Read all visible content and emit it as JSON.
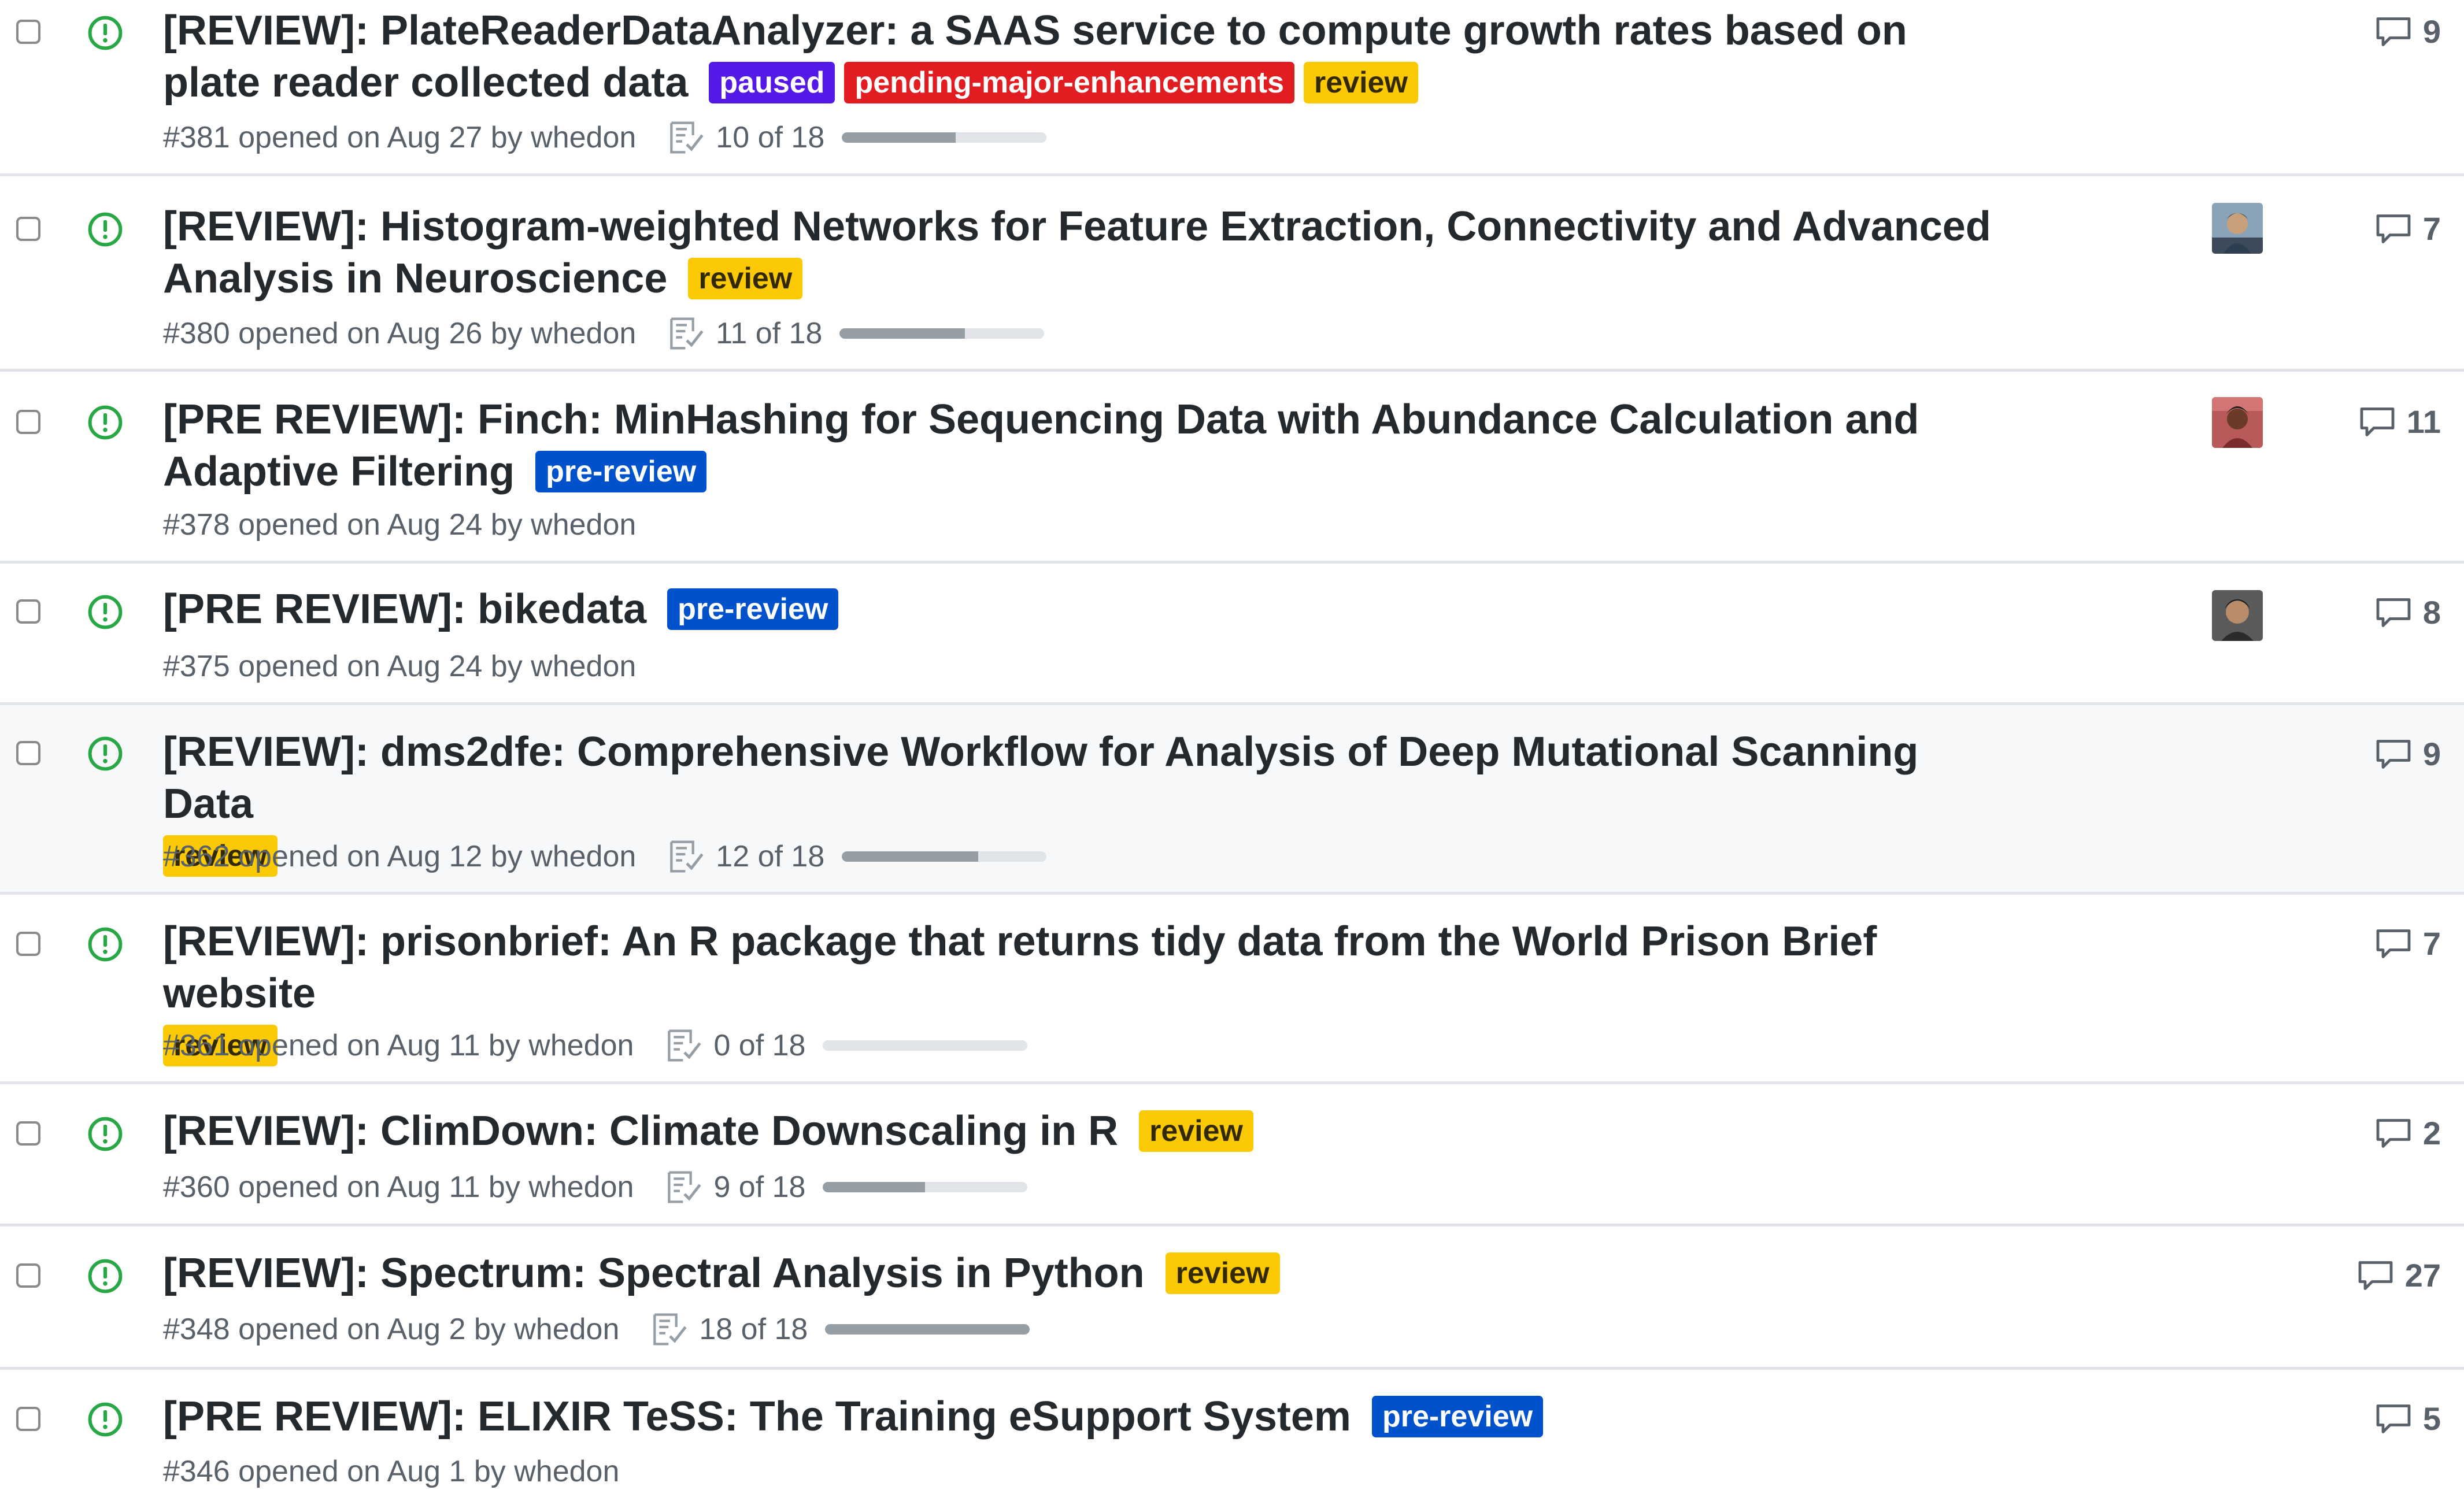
{
  "issues": [
    {
      "title": "[REVIEW]: PlateReaderDataAnalyzer: a SAAS service to compute growth rates based on plate reader collected data",
      "labels": [
        {
          "text": "paused",
          "kind": "paused"
        },
        {
          "text": "pending-major-enhancements",
          "kind": "pme"
        },
        {
          "text": "review",
          "kind": "review"
        }
      ],
      "meta": "#381 opened on Aug 27 by whedon",
      "tasks_text": "10 of 18",
      "tasks_progress": 0.556,
      "comments": "9",
      "has_avatar": false
    },
    {
      "title": "[REVIEW]: Histogram-weighted Networks for Feature Extraction, Connectivity and Advanced Analysis in Neuroscience",
      "labels": [
        {
          "text": "review",
          "kind": "review"
        }
      ],
      "meta": "#380 opened on Aug 26 by whedon",
      "tasks_text": "11 of 18",
      "tasks_progress": 0.611,
      "comments": "7",
      "has_avatar": true
    },
    {
      "title": "[PRE REVIEW]: Finch: MinHashing for Sequencing Data with Abundance Calculation and Adaptive Filtering",
      "labels": [
        {
          "text": "pre-review",
          "kind": "pre"
        }
      ],
      "meta": "#378 opened on Aug 24 by whedon",
      "tasks_text": null,
      "tasks_progress": null,
      "comments": "11",
      "has_avatar": true
    },
    {
      "title": "[PRE REVIEW]: bikedata",
      "labels": [
        {
          "text": "pre-review",
          "kind": "pre"
        }
      ],
      "meta": "#375 opened on Aug 24 by whedon",
      "tasks_text": null,
      "tasks_progress": null,
      "comments": "8",
      "has_avatar": true
    },
    {
      "title": "[REVIEW]: dms2dfe: Comprehensive Workflow for Analysis of Deep Mutational Scanning Data",
      "labels": [
        {
          "text": "review",
          "kind": "review"
        }
      ],
      "meta": "#362 opened on Aug 12 by whedon",
      "tasks_text": "12 of 18",
      "tasks_progress": 0.667,
      "comments": "9",
      "has_avatar": false
    },
    {
      "title": "[REVIEW]: prisonbrief: An R package that returns tidy data from the World Prison Brief website",
      "labels": [
        {
          "text": "review",
          "kind": "review"
        }
      ],
      "meta": "#361 opened on Aug 11 by whedon",
      "tasks_text": "0 of 18",
      "tasks_progress": 0.0,
      "comments": "7",
      "has_avatar": false
    },
    {
      "title": "[REVIEW]: ClimDown: Climate Downscaling in R",
      "labels": [
        {
          "text": "review",
          "kind": "review"
        }
      ],
      "meta": "#360 opened on Aug 11 by whedon",
      "tasks_text": "9 of 18",
      "tasks_progress": 0.5,
      "comments": "2",
      "has_avatar": false
    },
    {
      "title": "[REVIEW]: Spectrum: Spectral Analysis in Python",
      "labels": [
        {
          "text": "review",
          "kind": "review"
        }
      ],
      "meta": "#348 opened on Aug 2 by whedon",
      "tasks_text": "18 of 18",
      "tasks_progress": 1.0,
      "comments": "27",
      "has_avatar": false
    },
    {
      "title": "[PRE REVIEW]: ELIXIR TeSS: The Training eSupport System",
      "labels": [
        {
          "text": "pre-review",
          "kind": "pre"
        }
      ],
      "meta": "#346 opened on Aug 1 by whedon",
      "tasks_text": null,
      "tasks_progress": null,
      "comments": "5",
      "has_avatar": false
    }
  ],
  "colors": {
    "open_icon": "#28a745",
    "paused": "#5319e7",
    "pending_major_enhancements": "#e11d21",
    "review": "#fbca04",
    "pre_review": "#0052cc"
  }
}
